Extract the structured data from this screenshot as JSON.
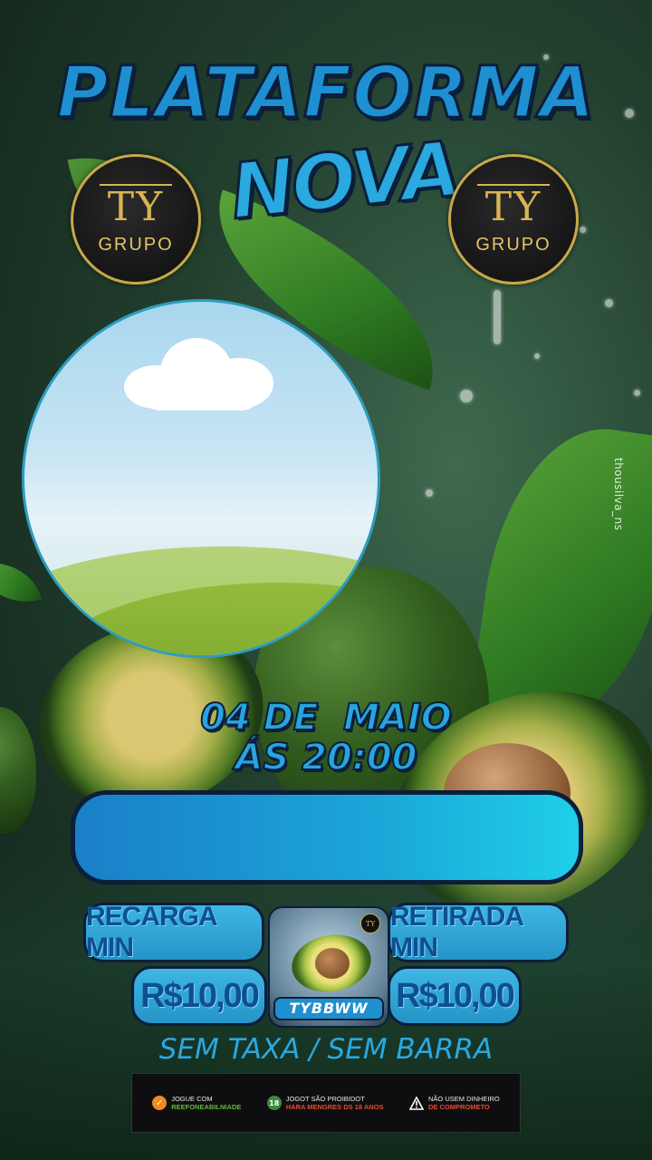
{
  "poster": {
    "title": "PLATAFORMA",
    "subtitle": "NOVA",
    "brand_left": {
      "monogram": "TY",
      "label": "GRUPO"
    },
    "brand_right": {
      "monogram": "TY",
      "label": "GRUPO"
    },
    "date_line1": "04 DE  MAIO",
    "date_line2": "ÁS 20:00",
    "deposit_label": "RECARGA MIN",
    "withdraw_label": "RETIRADA MIN",
    "deposit_value": "R$10,00",
    "withdraw_value": "R$10,00",
    "app_name": "TYBBWW",
    "app_badge": "TY",
    "tagline": "SEM TAXA / SEM BARRA",
    "watermark": "thousilva_ns"
  },
  "footer": {
    "items": [
      {
        "icon": "check-icon",
        "line1": "JOGUE COM",
        "line2": "REEFONEABILNIADE"
      },
      {
        "icon": "18-plus-icon",
        "line1": "JOGOT SÃO PROIBIDOT",
        "line2": "HARA MENGRES DS 18 ANOS"
      },
      {
        "icon": "warning-icon",
        "line1": "NÃO USEM DINHEIRO",
        "line2": "DE COMPROMETO"
      }
    ]
  },
  "colors": {
    "accent_blue": "#2aa8e0",
    "outline_navy": "#0b1e3a",
    "gold": "#c9a84a",
    "background_green": "#223f2e"
  }
}
